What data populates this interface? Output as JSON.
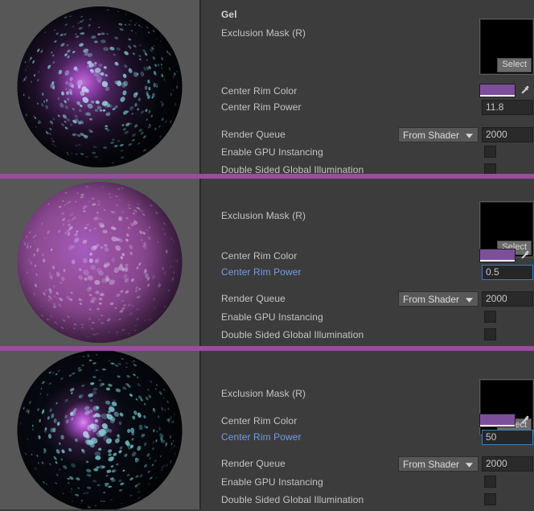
{
  "app": {
    "context": "unity-material-inspector",
    "accent_divider_color": "#9b4ba0",
    "active_label_color": "#6f9de4",
    "focus_border_color": "#3a7ebf",
    "panel_background": "#3c3c3c",
    "preview_background": "#575757"
  },
  "labels": {
    "section_header": "Gel",
    "exclusion_mask": "Exclusion Mask (R)",
    "center_rim_color": "Center Rim Color",
    "center_rim_power": "Center Rim Power",
    "render_queue": "Render Queue",
    "enable_gpu_instancing": "Enable GPU Instancing",
    "double_sided_gi": "Double Sided Global Illumination",
    "select_button": "Select"
  },
  "icons": {
    "eyedropper": "eyedropper-icon",
    "chevron_down": "chevron-down-icon"
  },
  "shared": {
    "render_queue_mode": "From Shader",
    "render_queue_value": "2000",
    "center_rim_color_hex": "#7d4f9b",
    "center_rim_color_alpha": "1",
    "gpu_instancing_checked": false,
    "double_sided_gi_checked": false,
    "exclusion_mask_texture": "none"
  },
  "panels": [
    {
      "id": "panel-1",
      "has_section_header": true,
      "center_rim_power": "11.8",
      "slider_percent": 24,
      "slider_focused": false,
      "power_label_active": false,
      "field_focused": false,
      "preview_style": "dark-wide",
      "preview_description": "dark sphere with cyan rim light and broad purple center glow"
    },
    {
      "id": "panel-2",
      "has_section_header": false,
      "center_rim_power": "0.5",
      "slider_percent": 1,
      "slider_focused": true,
      "power_label_active": true,
      "field_focused": true,
      "preview_style": "bright",
      "preview_description": "fully lit purple sphere with cyan rim light"
    },
    {
      "id": "panel-3",
      "has_section_header": false,
      "center_rim_power": "50",
      "slider_percent": 100,
      "slider_focused": true,
      "power_label_active": true,
      "field_focused": true,
      "preview_style": "dark-tight",
      "preview_description": "dark sphere with cyan rim light and tight small purple center glow"
    }
  ]
}
